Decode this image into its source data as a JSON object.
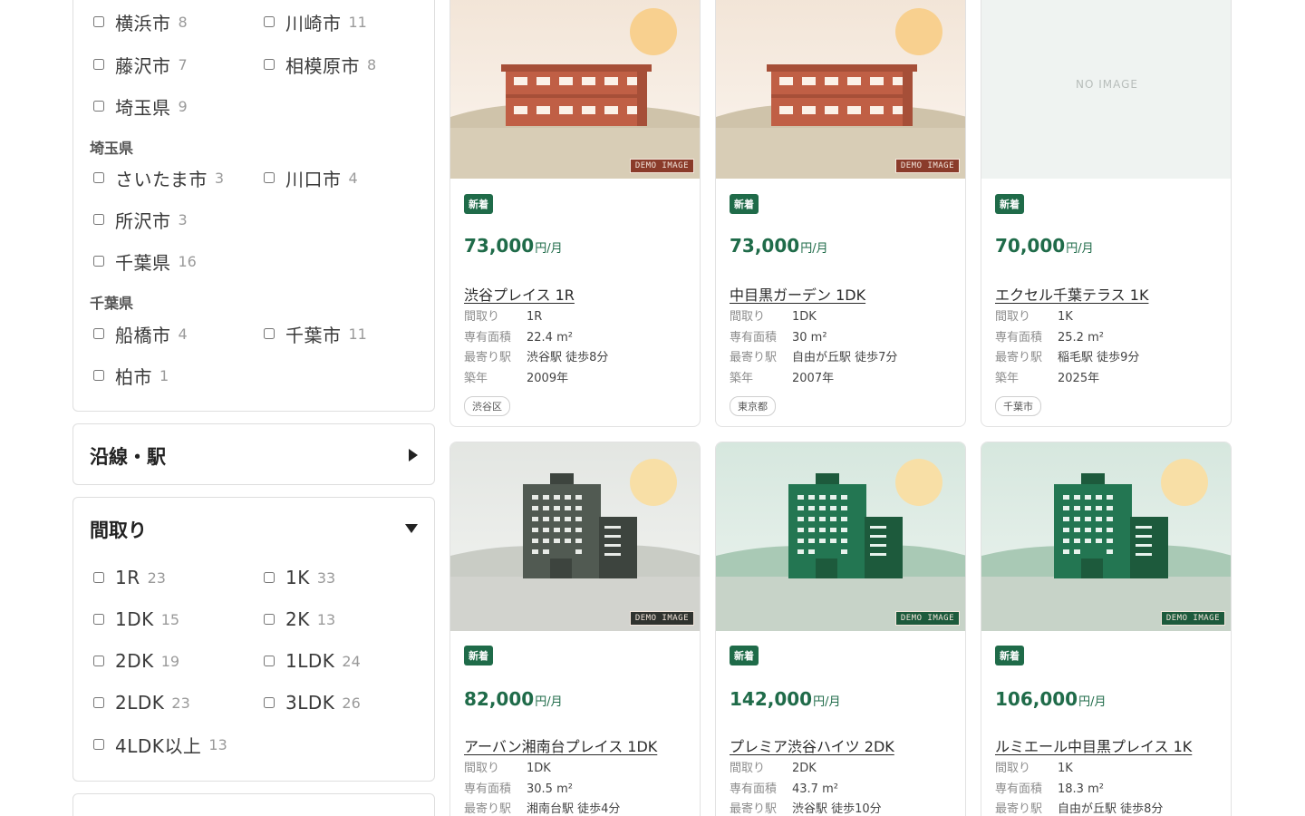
{
  "filters": {
    "area_options": [
      {
        "label": "横浜市",
        "count": "8"
      },
      {
        "label": "川崎市",
        "count": "11"
      },
      {
        "label": "藤沢市",
        "count": "7"
      },
      {
        "label": "相模原市",
        "count": "8"
      },
      {
        "label": "埼玉県",
        "count": "9"
      }
    ],
    "saitama_heading": "埼玉県",
    "saitama_options": [
      {
        "label": "さいたま市",
        "count": "3"
      },
      {
        "label": "川口市",
        "count": "4"
      },
      {
        "label": "所沢市",
        "count": "3"
      },
      {
        "label": "千葉県",
        "count": "16"
      }
    ],
    "chiba_heading": "千葉県",
    "chiba_options": [
      {
        "label": "船橋市",
        "count": "4"
      },
      {
        "label": "千葉市",
        "count": "11"
      },
      {
        "label": "柏市",
        "count": "1"
      }
    ],
    "line_title": "沿線・駅",
    "layout_title": "間取り",
    "layout_options": [
      {
        "label": "1R",
        "count": "23"
      },
      {
        "label": "1K",
        "count": "33"
      },
      {
        "label": "1DK",
        "count": "15"
      },
      {
        "label": "2K",
        "count": "13"
      },
      {
        "label": "2DK",
        "count": "19"
      },
      {
        "label": "1LDK",
        "count": "24"
      },
      {
        "label": "2LDK",
        "count": "23"
      },
      {
        "label": "3LDK",
        "count": "26"
      },
      {
        "label": "4LDK以上",
        "count": "13"
      }
    ]
  },
  "labels": {
    "badge": "新着",
    "price_unit": "円/月",
    "demo": "DEMO IMAGE",
    "no_image": "NO IMAGE",
    "layout": "間取り",
    "area": "専有面積",
    "station": "最寄り駅",
    "built": "築年"
  },
  "cards": [
    {
      "price": "73,000",
      "name": "渋谷プレイス 1R",
      "layout": "1R",
      "area": "22.4 m²",
      "station": "渋谷駅 徒歩8分",
      "built": "2009年",
      "tag": "渋谷区",
      "image": "lowrise"
    },
    {
      "price": "73,000",
      "name": "中目黒ガーデン 1DK",
      "layout": "1DK",
      "area": "30 m²",
      "station": "自由が丘駅 徒歩7分",
      "built": "2007年",
      "tag": "東京都",
      "image": "lowrise"
    },
    {
      "price": "70,000",
      "name": "エクセル千葉テラス 1K",
      "layout": "1K",
      "area": "25.2 m²",
      "station": "稲毛駅 徒歩9分",
      "built": "2025年",
      "tag": "千葉市",
      "image": "none"
    },
    {
      "price": "82,000",
      "name": "アーバン湘南台プレイス 1DK",
      "layout": "1DK",
      "area": "30.5 m²",
      "station": "湘南台駅 徒歩4分",
      "image": "tower-gray"
    },
    {
      "price": "142,000",
      "name": "プレミア渋谷ハイツ 2DK",
      "layout": "2DK",
      "area": "43.7 m²",
      "station": "渋谷駅 徒歩10分",
      "image": "tower-green"
    },
    {
      "price": "106,000",
      "name": "ルミエール中目黒プレイス 1K",
      "layout": "1K",
      "area": "18.3 m²",
      "station": "自由が丘駅 徒歩8分",
      "image": "tower-green"
    }
  ],
  "colors": {
    "accent": "#1f6b49",
    "demo_badge": "#8a3b2a"
  }
}
